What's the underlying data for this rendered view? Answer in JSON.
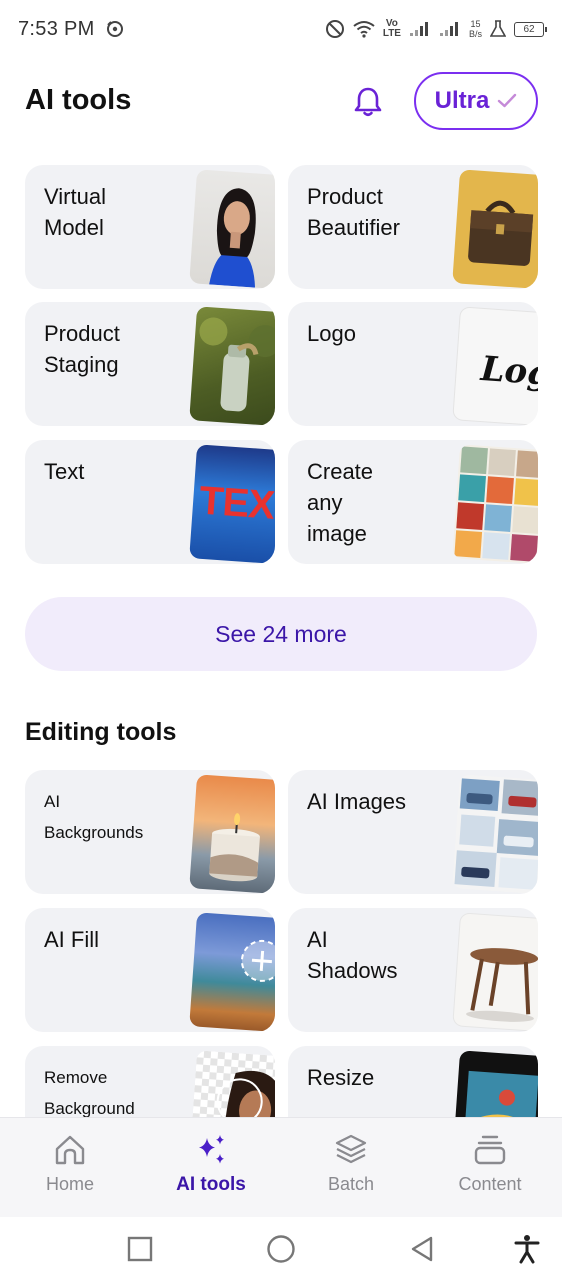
{
  "status_bar": {
    "time": "7:53 PM",
    "net_speed_value": "15",
    "net_speed_unit": "B/s",
    "network_label_top": "Vo",
    "network_label_bottom": "LTE",
    "battery": "62"
  },
  "header": {
    "title": "AI tools",
    "ultra_label": "Ultra"
  },
  "ai_tools": [
    {
      "label": "Virtual\nModel"
    },
    {
      "label": "Product\nBeautifier"
    },
    {
      "label": "Product\nStaging"
    },
    {
      "label": "Logo"
    },
    {
      "label": "Text"
    },
    {
      "label": "Create\nany\nimage"
    }
  ],
  "see_more_label": "See 24 more",
  "editing_section_title": "Editing tools",
  "editing_tools": [
    {
      "label": "AI\nBackgrounds"
    },
    {
      "label": "AI Images"
    },
    {
      "label": "AI Fill"
    },
    {
      "label": "AI\nShadows"
    },
    {
      "label": "Remove\nBackground"
    },
    {
      "label": "Resize"
    }
  ],
  "thumb_text": {
    "logo": "Logo",
    "text": "TEX"
  },
  "bottom_nav": [
    {
      "label": "Home",
      "icon": "home-icon"
    },
    {
      "label": "AI tools",
      "icon": "sparkles-icon",
      "active": true
    },
    {
      "label": "Batch",
      "icon": "layers-icon"
    },
    {
      "label": "Content",
      "icon": "stack-icon"
    }
  ],
  "colors": {
    "accent": "#6a22d6",
    "accent_dark": "#3b16a8",
    "card_bg": "#f1f2f5",
    "see_more_bg": "#f1ecfb"
  }
}
